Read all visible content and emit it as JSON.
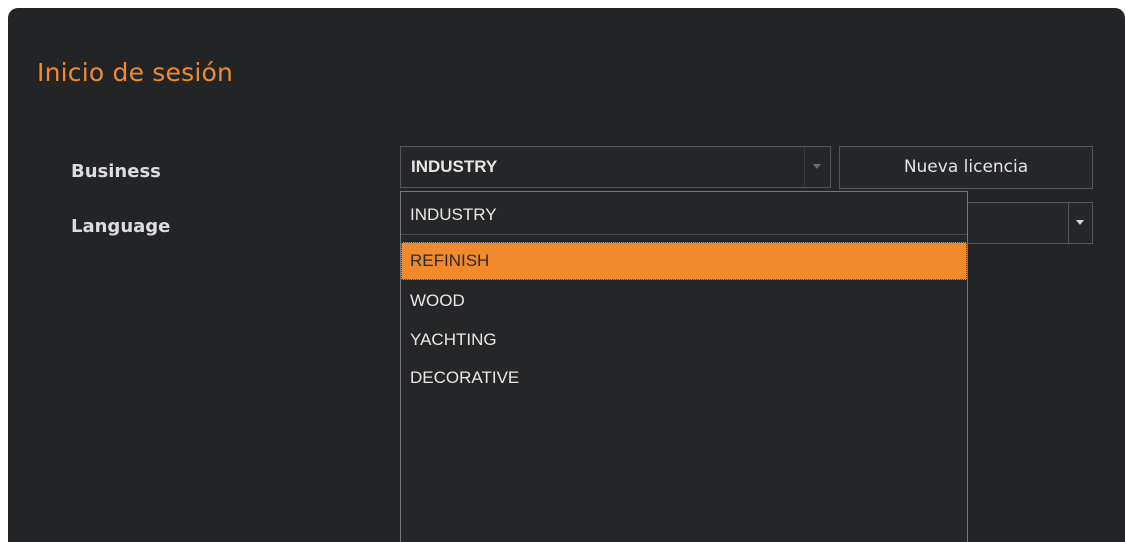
{
  "dialog": {
    "title": "Inicio de sesión"
  },
  "form": {
    "business_label": "Business",
    "language_label": "Language",
    "business_value": "INDUSTRY",
    "new_license_button": "Nueva licencia"
  },
  "dropdown": {
    "options": [
      "INDUSTRY",
      "REFINISH",
      "WOOD",
      "YACHTING",
      "DECORATIVE"
    ],
    "highlighted": "REFINISH"
  },
  "colors": {
    "accent": "#f28a2f",
    "highlight": "#f18a2c",
    "background": "#232426"
  },
  "icons": {
    "business_dropdown": "chevron-down-icon",
    "language_dropdown": "chevron-down-icon"
  }
}
